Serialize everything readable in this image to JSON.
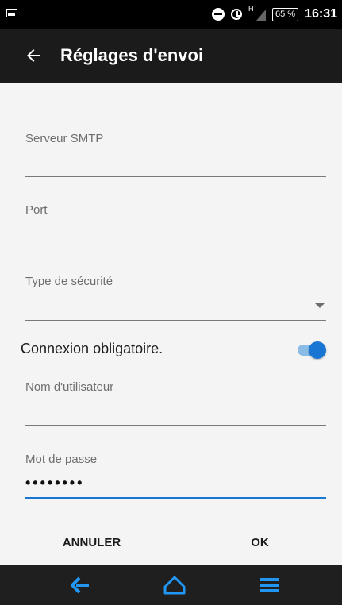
{
  "status_bar": {
    "signal_label": "H",
    "battery": "65 %",
    "time": "16:31"
  },
  "app_bar": {
    "title": "Réglages d'envoi"
  },
  "form": {
    "smtp_server": {
      "label": "Serveur SMTP",
      "value": ""
    },
    "port": {
      "label": "Port",
      "value": ""
    },
    "security_type": {
      "label": "Type de sécurité",
      "value": ""
    },
    "login_required": {
      "label": "Connexion obligatoire.",
      "on": true
    },
    "username": {
      "label": "Nom d'utilisateur",
      "value": ""
    },
    "password": {
      "label": "Mot de passe",
      "value": "••••••••"
    }
  },
  "buttons": {
    "cancel": "ANNULER",
    "ok": "OK"
  },
  "colors": {
    "accent": "#1976d2",
    "accent_light": "#8bbce6",
    "app_bar": "#1b1b1b",
    "nav_icon": "#2196f3"
  },
  "nav_bar": {
    "icons": [
      "back-arrow-icon",
      "home-icon",
      "menu-icon"
    ]
  }
}
